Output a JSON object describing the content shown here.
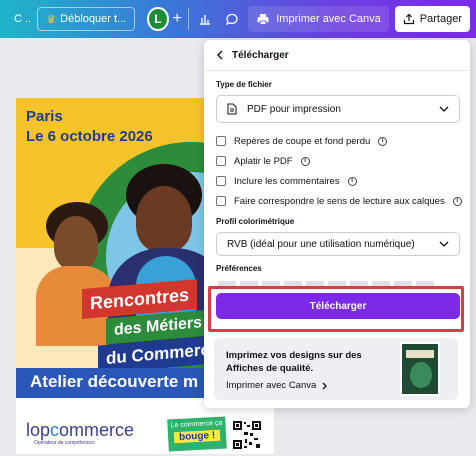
{
  "toolbar": {
    "crumb": "C ...",
    "unlock_label": "Débloquer t...",
    "avatar_initial": "L",
    "print_label": "Imprimer avec Canva",
    "share_label": "Partager"
  },
  "poster": {
    "city": "Paris",
    "date": "Le 6 octobre 2026",
    "line1": "Rencontres",
    "line2": "des Métiers",
    "line3": "du Commerce",
    "workshop": "Atelier découverte m",
    "logo_name": "lopcommerce",
    "logo_prefix": "lop",
    "logo_suffix": "mmerce",
    "logo_sub": "Opérateur de compétences",
    "badge_small": "Le commerce ça",
    "badge_big": "bouge !"
  },
  "panel": {
    "back_label": "Télécharger",
    "file_type_label": "Type de fichier",
    "file_type_value": "PDF pour impression",
    "options": [
      {
        "label": "Repères de coupe et fond perdu",
        "checked": false
      },
      {
        "label": "Aplatir le PDF",
        "checked": false
      },
      {
        "label": "Inclure les commentaires",
        "checked": false
      },
      {
        "label": "Faire correspondre le sens de lecture aux calques",
        "checked": false
      }
    ],
    "color_profile_label": "Profil colorimétrique",
    "color_profile_value": "RVB (idéal pour une utilisation numérique)",
    "preferences_label": "Préférences",
    "download_button": "Télécharger",
    "promo_title": "Imprimez vos designs sur des Affiches de qualité.",
    "promo_link": "Imprimer avec Canva",
    "promo_thumb_text": "PLANTS"
  },
  "colors": {
    "accent": "#7d2ae8",
    "highlight": "#e0394a"
  }
}
